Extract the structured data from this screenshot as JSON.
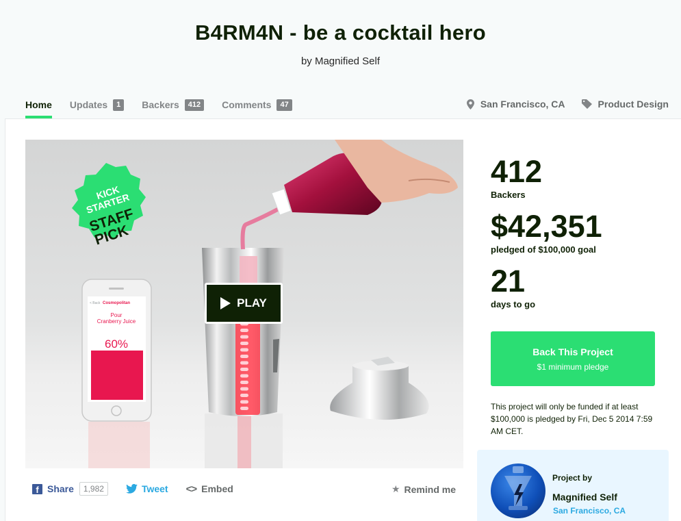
{
  "project": {
    "title": "B4RM4N - be a cocktail hero",
    "byline": "by Magnified Self"
  },
  "nav": {
    "home": "Home",
    "updates": {
      "label": "Updates",
      "count": "1"
    },
    "backers": {
      "label": "Backers",
      "count": "412"
    },
    "comments": {
      "label": "Comments",
      "count": "47"
    }
  },
  "meta": {
    "location": "San Francisco, CA",
    "category": "Product Design"
  },
  "video": {
    "play_label": "PLAY",
    "badge_text": [
      "KICK",
      "STARTER",
      "STAFF",
      "PICK"
    ],
    "phone": {
      "back": "< Back",
      "title": "Cosmopolitan",
      "instruction_line1": "Pour",
      "instruction_line2": "Cranberry Juice",
      "percent": "60%",
      "fill_fraction": 0.6
    }
  },
  "share": {
    "facebook_label": "Share",
    "facebook_count": "1,982",
    "tweet_label": "Tweet",
    "embed_label": "Embed",
    "remind_label": "Remind me"
  },
  "stats": {
    "backers": "412",
    "backers_label": "Backers",
    "pledged": "$42,351",
    "pledged_label": "pledged of $100,000 goal",
    "days": "21",
    "days_label": "days to go"
  },
  "back_button": {
    "label": "Back This Project",
    "sub": "$1 minimum pledge"
  },
  "funding_note": "This project will only be funded if at least $100,000 is pledged by Fri, Dec 5 2014 7:59 AM CET.",
  "creator": {
    "project_by": "Project by",
    "name": "Magnified Self",
    "location": "San Francisco, CA"
  },
  "colors": {
    "brand_green": "#2bde73",
    "dark": "#0f2105",
    "twitter": "#2ba9e1",
    "facebook": "#3b5998",
    "badge_green": "#2bde73"
  }
}
